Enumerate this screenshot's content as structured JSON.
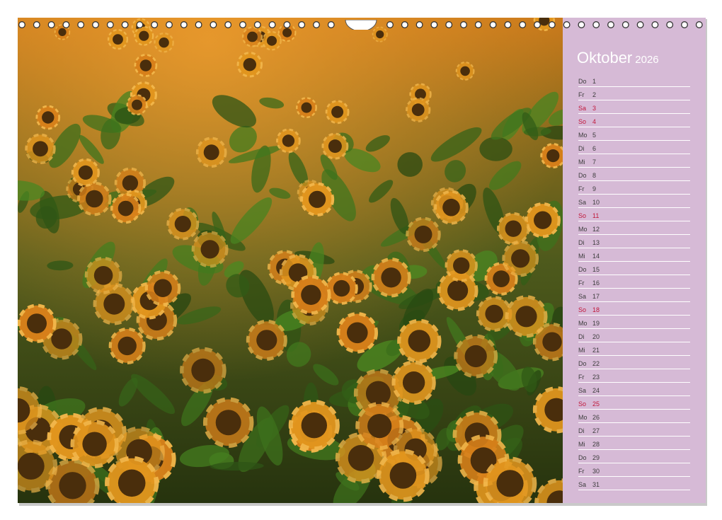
{
  "calendar": {
    "month": "Oktober",
    "year": "2026",
    "accent_color": "#d6bad6",
    "weekend_color": "#c0183a",
    "days": [
      {
        "wd": "Do",
        "d": "1",
        "weekend": false
      },
      {
        "wd": "Fr",
        "d": "2",
        "weekend": false
      },
      {
        "wd": "Sa",
        "d": "3",
        "weekend": true
      },
      {
        "wd": "So",
        "d": "4",
        "weekend": true
      },
      {
        "wd": "Mo",
        "d": "5",
        "weekend": false
      },
      {
        "wd": "Di",
        "d": "6",
        "weekend": false
      },
      {
        "wd": "Mi",
        "d": "7",
        "weekend": false
      },
      {
        "wd": "Do",
        "d": "8",
        "weekend": false
      },
      {
        "wd": "Fr",
        "d": "9",
        "weekend": false
      },
      {
        "wd": "Sa",
        "d": "10",
        "weekend": false
      },
      {
        "wd": "So",
        "d": "11",
        "weekend": true
      },
      {
        "wd": "Mo",
        "d": "12",
        "weekend": false
      },
      {
        "wd": "Di",
        "d": "13",
        "weekend": false
      },
      {
        "wd": "Mi",
        "d": "14",
        "weekend": false
      },
      {
        "wd": "Do",
        "d": "15",
        "weekend": false
      },
      {
        "wd": "Fr",
        "d": "16",
        "weekend": false
      },
      {
        "wd": "Sa",
        "d": "17",
        "weekend": false
      },
      {
        "wd": "So",
        "d": "18",
        "weekend": true
      },
      {
        "wd": "Mo",
        "d": "19",
        "weekend": false
      },
      {
        "wd": "Di",
        "d": "20",
        "weekend": false
      },
      {
        "wd": "Mi",
        "d": "21",
        "weekend": false
      },
      {
        "wd": "Do",
        "d": "22",
        "weekend": false
      },
      {
        "wd": "Fr",
        "d": "23",
        "weekend": false
      },
      {
        "wd": "Sa",
        "d": "24",
        "weekend": false
      },
      {
        "wd": "So",
        "d": "25",
        "weekend": true
      },
      {
        "wd": "Mo",
        "d": "26",
        "weekend": false
      },
      {
        "wd": "Di",
        "d": "27",
        "weekend": false
      },
      {
        "wd": "Mi",
        "d": "28",
        "weekend": false
      },
      {
        "wd": "Do",
        "d": "29",
        "weekend": false
      },
      {
        "wd": "Fr",
        "d": "30",
        "weekend": false
      },
      {
        "wd": "Sa",
        "d": "31",
        "weekend": false
      }
    ]
  },
  "photo": {
    "subject_icon": "sunflower-field-photo"
  }
}
